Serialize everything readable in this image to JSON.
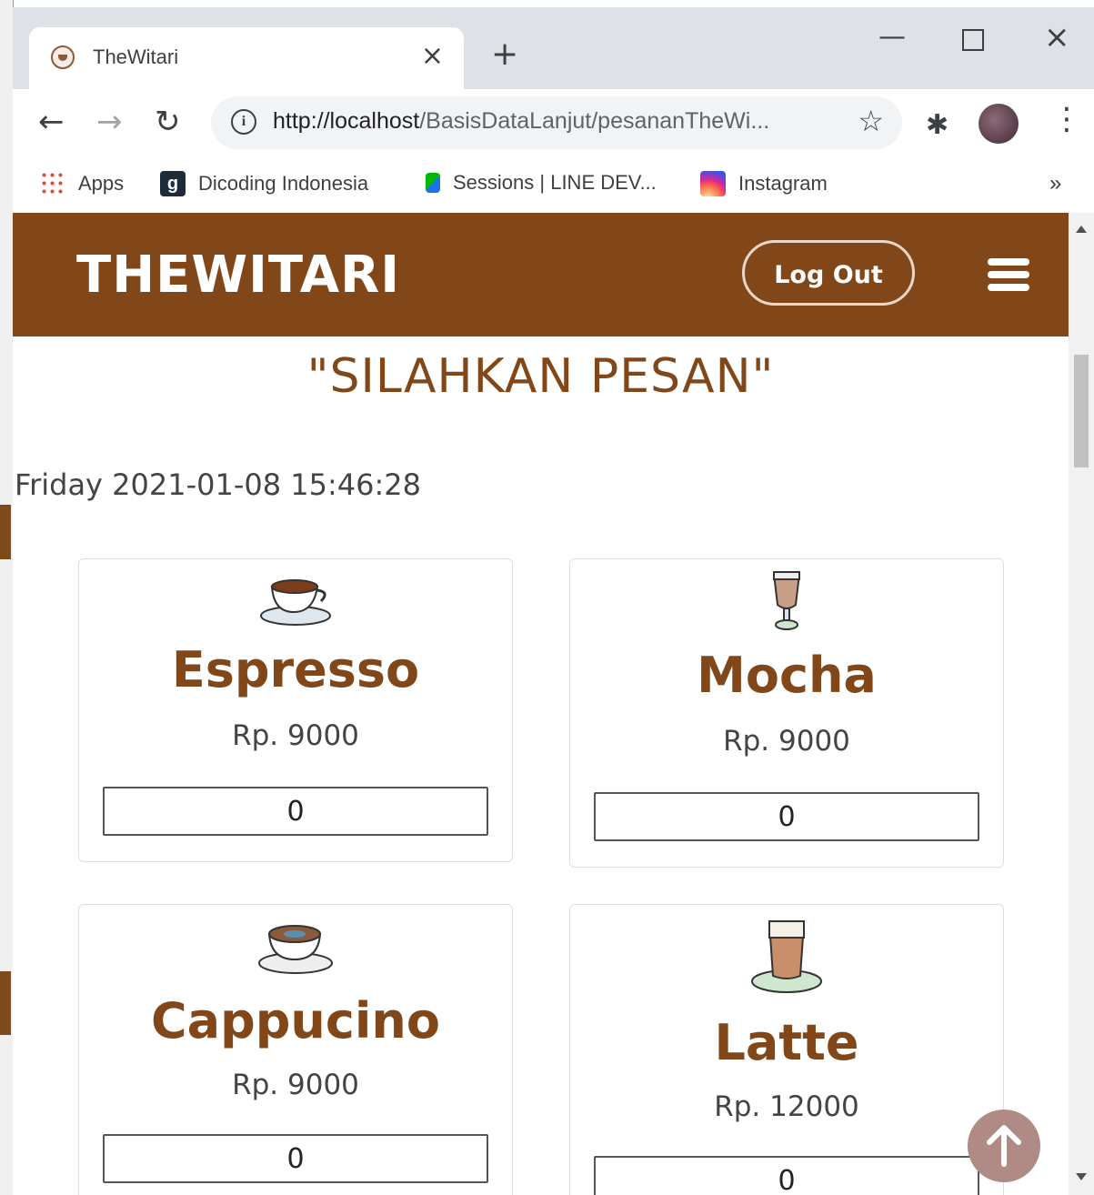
{
  "browser": {
    "tab_title": "TheWitari",
    "url_host": "http://localhost",
    "url_path": "/BasisDataLanjut/pesananTheWi...",
    "bookmarks": [
      {
        "label": "Apps",
        "icon": "apps-grid-icon"
      },
      {
        "label": "Dicoding Indonesia",
        "icon": "dicoding-icon"
      },
      {
        "label": "Sessions | LINE DEV...",
        "icon": "line-dev-icon"
      },
      {
        "label": "Instagram",
        "icon": "instagram-icon"
      }
    ],
    "more_bookmarks": "»"
  },
  "navbar": {
    "brand": "THEWITARI",
    "logout_label": "Log Out",
    "background": "#824718"
  },
  "page": {
    "heading": "\"SILAHKAN PESAN\"",
    "datetime": "Friday 2021-01-08 15:46:28"
  },
  "menu": [
    {
      "name": "Espresso",
      "price": "Rp. 9000",
      "qty": "0",
      "icon": "espresso-cup-icon"
    },
    {
      "name": "Mocha",
      "price": "Rp. 9000",
      "qty": "0",
      "icon": "mocha-glass-icon"
    },
    {
      "name": "Cappucino",
      "price": "Rp. 9000",
      "qty": "0",
      "icon": "cappuccino-cup-icon"
    },
    {
      "name": "Latte",
      "price": "Rp. 12000",
      "qty": "0",
      "icon": "latte-glass-icon"
    }
  ]
}
